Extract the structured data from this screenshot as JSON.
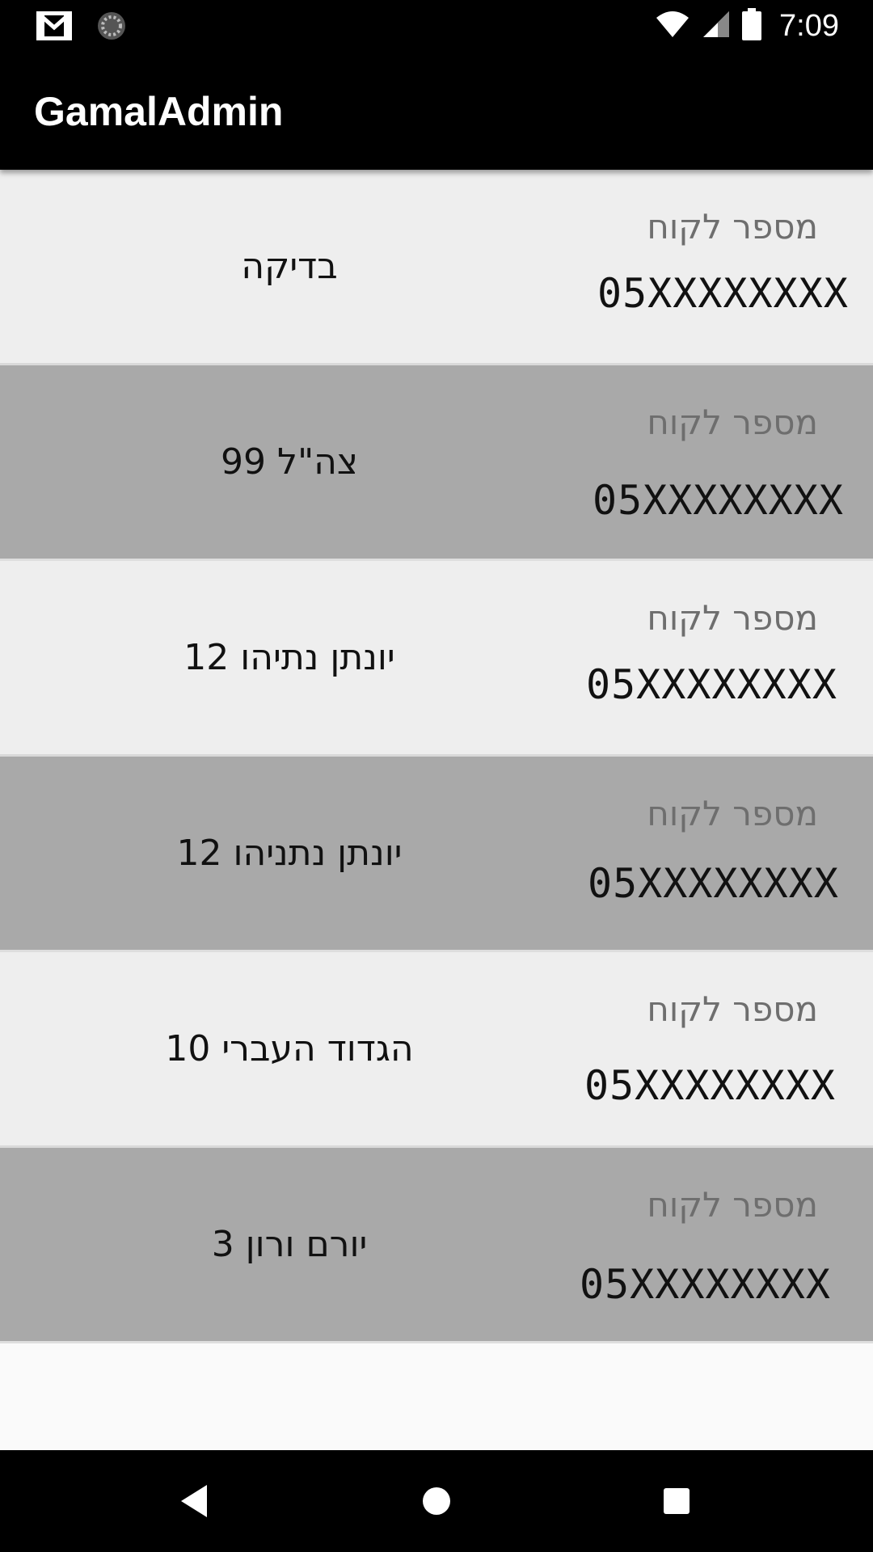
{
  "status_bar": {
    "time": "7:09",
    "icons": [
      "gmail-icon",
      "sync-icon",
      "wifi-icon",
      "signal-icon",
      "battery-icon"
    ]
  },
  "app_bar": {
    "title": "GamalAdmin",
    "background": "#000000"
  },
  "customers": [
    {
      "address": "בדיקה",
      "label": "מספר לקוח",
      "phone": "05XXXXXXXX"
    },
    {
      "address": "צה\"ל 99",
      "label": "מספר לקוח",
      "phone": "05XXXXXXXX"
    },
    {
      "address": "יונתן נתיהו 12",
      "label": "מספר לקוח",
      "phone": "05XXXXXXXX"
    },
    {
      "address": "יונתן נתניהו 12",
      "label": "מספר לקוח",
      "phone": "05XXXXXXXX"
    },
    {
      "address": "הגדוד העברי 10",
      "label": "מספר לקוח",
      "phone": "05XXXXXXXX"
    },
    {
      "address": "יורם ורון 3",
      "label": "מספר לקוח",
      "phone": "05XXXXXXXX"
    }
  ],
  "colors": {
    "row_light": "#eeeeee",
    "row_dark": "#a9a9a9",
    "label_gray": "#6e6e6e"
  },
  "nav_bar": {
    "icons": [
      "back-icon",
      "home-icon",
      "recents-icon"
    ]
  }
}
